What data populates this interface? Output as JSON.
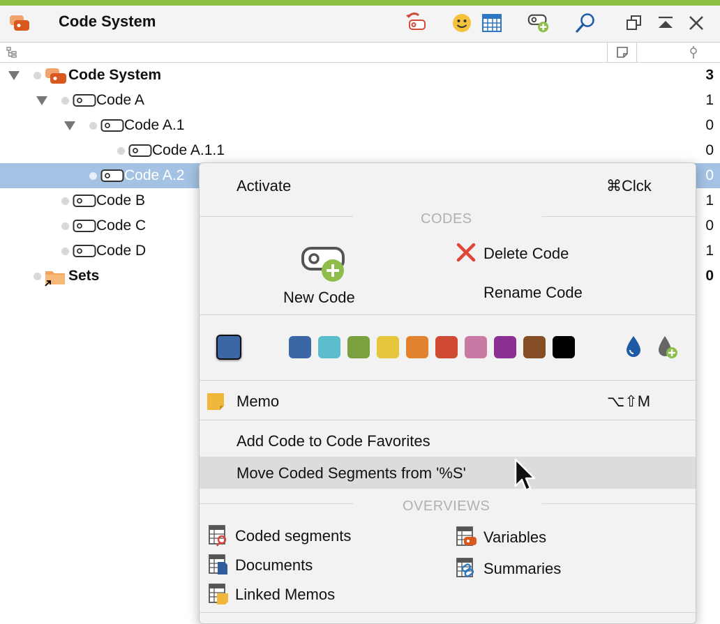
{
  "window": {
    "title": "Code System"
  },
  "tree": {
    "rows": [
      {
        "label": "Code System",
        "count": "3"
      },
      {
        "label": "Code A",
        "count": "1"
      },
      {
        "label": "Code A.1",
        "count": "0"
      },
      {
        "label": "Code A.1.1",
        "count": "0"
      },
      {
        "label": "Code A.2",
        "count": "0"
      },
      {
        "label": "Code B",
        "count": "1"
      },
      {
        "label": "Code C",
        "count": "0"
      },
      {
        "label": "Code D",
        "count": "1"
      },
      {
        "label": "Sets",
        "count": "0"
      }
    ]
  },
  "menu": {
    "activate": {
      "label": "Activate",
      "shortcut": "⌘Clck"
    },
    "codes_header": "CODES",
    "new_code": "New Code",
    "delete_code": "Delete Code",
    "rename_code": "Rename Code",
    "colors": [
      "#3b67a6",
      "#5bbccc",
      "#7ba13e",
      "#e6c53c",
      "#e2822f",
      "#d04a34",
      "#c97aa4",
      "#8b2f93",
      "#864c24",
      "#000000"
    ],
    "selected_color": "#3b67a6",
    "memo": {
      "label": "Memo",
      "shortcut": "⌥⇧M"
    },
    "add_favorites": "Add Code to Code Favorites",
    "move_segments": "Move Coded Segments from '%S'",
    "overviews_header": "OVERVIEWS",
    "overviews": {
      "coded_segments": "Coded segments",
      "variables": "Variables",
      "documents": "Documents",
      "summaries": "Summaries",
      "linked_memos": "Linked Memos"
    }
  }
}
